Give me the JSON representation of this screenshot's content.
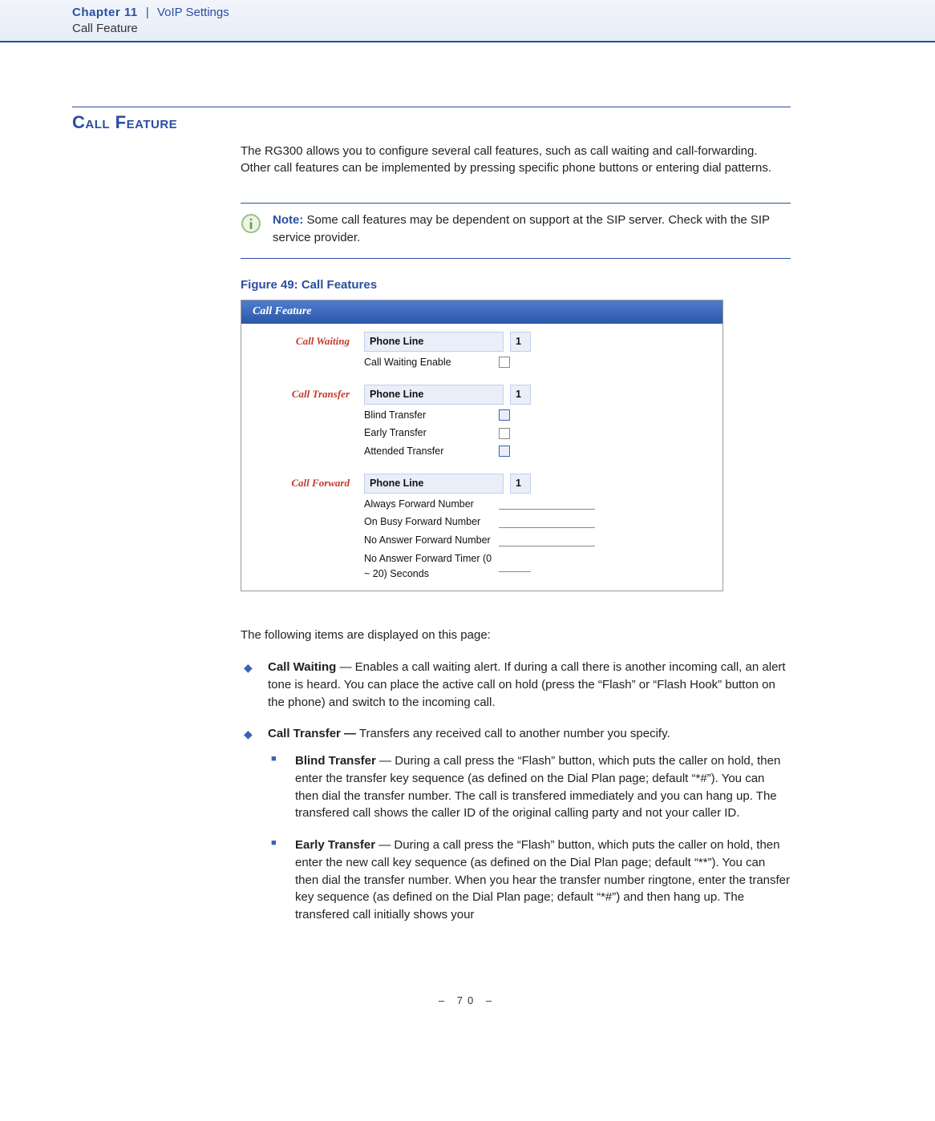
{
  "runhead": {
    "chapter": "Chapter 11",
    "sep": "|",
    "section": "VoIP Settings",
    "subsection": "Call Feature"
  },
  "heading": "Call Feature",
  "intro": "The RG300 allows you to configure several call features, such as call waiting and call-forwarding. Other call features can be implemented by pressing specific phone buttons or entering dial patterns.",
  "note": {
    "label": "Note:",
    "text": " Some call features may be dependent on support at the SIP server. Check with the SIP service provider."
  },
  "figure": {
    "caption": "Figure 49:  Call Features",
    "panel_title": "Call Feature",
    "groups": {
      "call_waiting": {
        "title": "Call Waiting",
        "phone_line_label": "Phone Line",
        "phone_line_value": "1",
        "enable_label": "Call Waiting Enable"
      },
      "call_transfer": {
        "title": "Call Transfer",
        "phone_line_label": "Phone Line",
        "phone_line_value": "1",
        "blind_label": "Blind Transfer",
        "early_label": "Early Transfer",
        "attended_label": "Attended Transfer"
      },
      "call_forward": {
        "title": "Call Forward",
        "phone_line_label": "Phone Line",
        "phone_line_value": "1",
        "always_label": "Always Forward Number",
        "onbusy_label": "On Busy Forward Number",
        "noanswer_label": "No Answer Forward Number",
        "timer_label": "No Answer Forward Timer (0 ~ 20) Seconds"
      }
    }
  },
  "after_figure_text": "The following items are displayed on this page:",
  "bullets": {
    "call_waiting": {
      "title": "Call Waiting",
      "text": " — Enables a call waiting alert. If during a call there is another incoming call, an alert tone is heard. You can place the active call on hold (press the “Flash” or “Flash Hook” button on the phone) and switch to the incoming call."
    },
    "call_transfer": {
      "title": "Call Transfer —",
      "text": " Transfers any received call to another number you specify.",
      "sub": {
        "blind": {
          "title": "Blind Transfer",
          "text": " — During a call press the “Flash” button, which puts the caller on hold, then enter the transfer key sequence (as defined on the Dial Plan page; default “*#”). You can then dial the transfer number. The call is transfered immediately and you can hang up. The transfered call shows the caller ID of the original calling party and not your caller ID."
        },
        "early": {
          "title": "Early Transfer",
          "text": " — During a call press the “Flash” button, which puts the caller on hold, then enter the new call key sequence (as defined on the Dial Plan page; default “**”). You can then dial the transfer number. When you hear the transfer number ringtone, enter the transfer key sequence (as defined on the Dial Plan page; default “*#”) and then hang up. The transfered call initially shows your"
        }
      }
    }
  },
  "footer": "–  70  –"
}
